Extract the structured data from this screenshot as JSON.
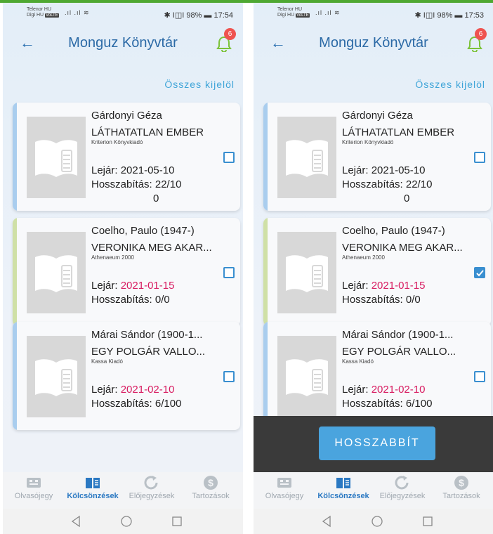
{
  "screens": [
    {
      "status": {
        "carrier1": "Telenor HU",
        "carrier2": "Digi HU",
        "carrier_tag": "VoLTE",
        "battery_time": "✱ I◫I 98% ▬ 17:54"
      },
      "appbar": {
        "title": "Monguz Könyvtár",
        "badge": "6"
      },
      "select_all": "Összes kijelöl",
      "loans": [
        {
          "author": "Gárdonyi Géza",
          "title": "LÁTHATATLAN EMBER",
          "publisher": "Kriterion Könyvkiadó",
          "due_label": "Lejár:",
          "due": "2021-05-10",
          "overdue": false,
          "ext": "Hosszabítás: 22/10",
          "ext2": "0",
          "checked": false,
          "stripe": "#a9cdee"
        },
        {
          "author": "Coelho, Paulo (1947-)",
          "title": "VERONIKA MEG AKAR...",
          "publisher": "Athenaeum 2000",
          "due_label": "Lejár:",
          "due": "2021-01-15",
          "overdue": true,
          "ext": "Hosszabítás: 0/0",
          "ext2": "",
          "checked": false,
          "stripe": "#cfe0a6"
        },
        {
          "author": "Márai Sándor (1900-1...",
          "title": "EGY POLGÁR VALLO...",
          "publisher": "Kassa Kiadó",
          "due_label": "Lejár:",
          "due": "2021-02-10",
          "overdue": true,
          "ext": "Hosszabítás: 6/100",
          "ext2": "",
          "checked": false,
          "stripe": "#a9cdee"
        }
      ],
      "renew_button": null
    },
    {
      "status": {
        "carrier1": "Telenor HU",
        "carrier2": "Digi HU",
        "carrier_tag": "VoLTE",
        "battery_time": "✱ I◫I 98% ▬ 17:53"
      },
      "appbar": {
        "title": "Monguz Könyvtár",
        "badge": "6"
      },
      "select_all": "Összes kijelöl",
      "loans": [
        {
          "author": "Gárdonyi Géza",
          "title": "LÁTHATATLAN EMBER",
          "publisher": "Kriterion Könyvkiadó",
          "due_label": "Lejár:",
          "due": "2021-05-10",
          "overdue": false,
          "ext": "Hosszabítás: 22/10",
          "ext2": "0",
          "checked": false,
          "stripe": "#a9cdee"
        },
        {
          "author": "Coelho, Paulo (1947-)",
          "title": "VERONIKA MEG AKAR...",
          "publisher": "Athenaeum 2000",
          "due_label": "Lejár:",
          "due": "2021-01-15",
          "overdue": true,
          "ext": "Hosszabítás: 0/0",
          "ext2": "",
          "checked": true,
          "stripe": "#cfe0a6"
        },
        {
          "author": "Márai Sándor (1900-1...",
          "title": "EGY POLGÁR VALLO...",
          "publisher": "Kassa Kiadó",
          "due_label": "Lejár:",
          "due": "2021-02-10",
          "overdue": true,
          "ext": "Hosszabítás: 6/100",
          "ext2": "",
          "checked": false,
          "stripe": "#a9cdee"
        }
      ],
      "renew_button": "HOSSZABBÍT"
    }
  ],
  "nav": [
    {
      "label": "Olvasójegy",
      "icon": "ticket-icon",
      "active": false
    },
    {
      "label": "Kölcsönzések",
      "icon": "book-icon",
      "active": true
    },
    {
      "label": "Előjegyzések",
      "icon": "refresh-icon",
      "active": false
    },
    {
      "label": "Tartozások",
      "icon": "dollar-icon",
      "active": false
    }
  ],
  "colors": {
    "accent": "#2a78c2",
    "overdue": "#d81b60",
    "renew": "#4aa4de"
  }
}
